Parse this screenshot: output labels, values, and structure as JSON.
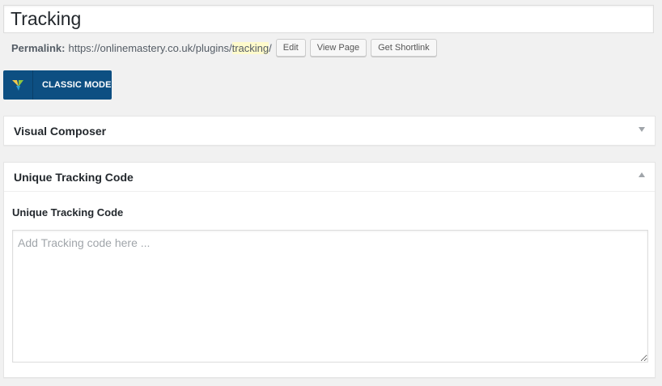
{
  "title": {
    "value": "Tracking"
  },
  "permalink": {
    "label": "Permalink:",
    "base": "https://onlinemastery.co.uk/plugins/",
    "slug": "tracking",
    "trail": "/",
    "buttons": {
      "edit": "Edit",
      "view": "View Page",
      "shortlink": "Get Shortlink"
    }
  },
  "classic_mode": {
    "label": "CLASSIC MODE",
    "accent": "#0d4f82"
  },
  "visual_composer": {
    "title": "Visual Composer"
  },
  "tracking_box": {
    "title": "Unique Tracking Code",
    "field_label": "Unique Tracking Code",
    "placeholder": "Add Tracking code here ..."
  }
}
